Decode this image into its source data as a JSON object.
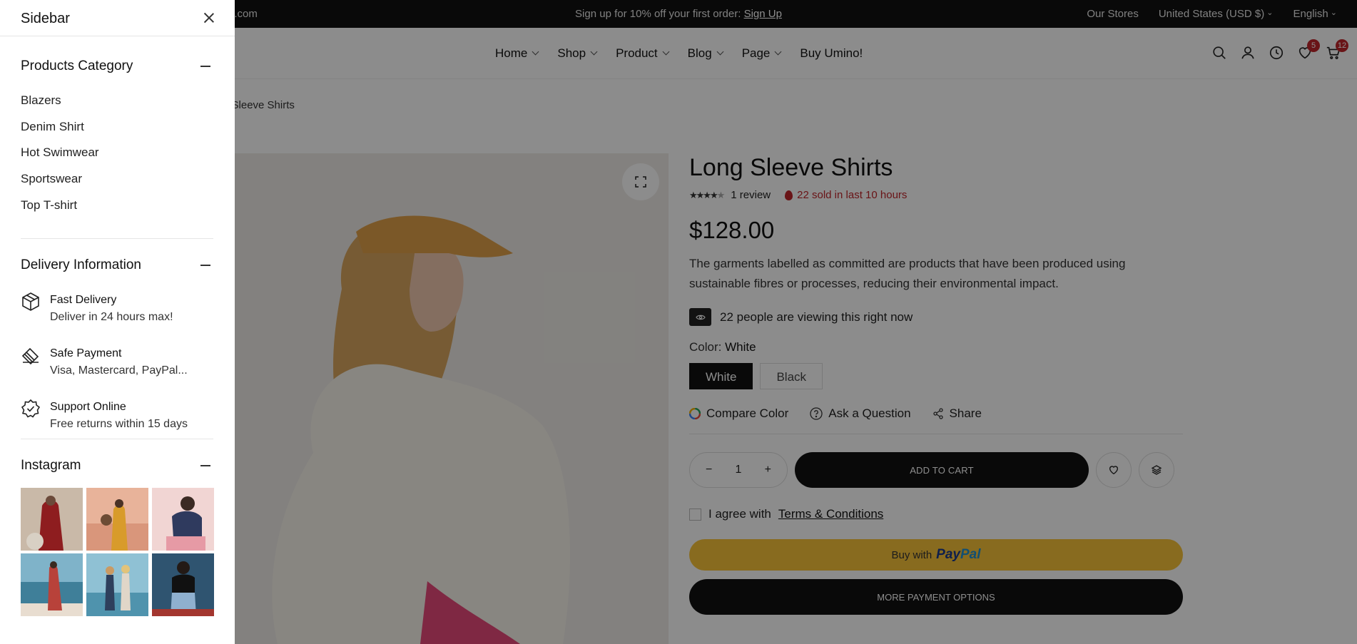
{
  "topbar": {
    "left_text": "l.com",
    "promo_text": "Sign up for 10% off your first order:",
    "promo_link": "Sign Up",
    "our_stores": "Our Stores",
    "currency": "United States (USD $)",
    "language": "English"
  },
  "nav": {
    "items": [
      {
        "label": "Home"
      },
      {
        "label": "Shop"
      },
      {
        "label": "Product"
      },
      {
        "label": "Blog"
      },
      {
        "label": "Page"
      },
      {
        "label": "Buy Umino!"
      }
    ]
  },
  "header": {
    "wishlist_count": "5",
    "cart_count": "12"
  },
  "breadcrumb": "g Sleeve Shirts",
  "product": {
    "title": "Long Sleeve Shirts",
    "rating": 4,
    "rating_max": 5,
    "reviews": "1 review",
    "sold": "22 sold in last 10 hours",
    "price": "$128.00",
    "description": "The garments labelled as committed are products that have been produced using sustainable fibres or processes, reducing their environmental impact.",
    "viewing": "22 people are viewing this right now",
    "color_label": "Color:",
    "color_value": "White",
    "colors": [
      "White",
      "Black"
    ],
    "compare_color": "Compare Color",
    "ask_question": "Ask a Question",
    "share": "Share",
    "quantity": "1",
    "add_to_cart": "ADD TO CART",
    "agree_text": "I agree with",
    "terms_link": "Terms & Conditions",
    "buy_with": "Buy with",
    "paypal_pay": "Pay",
    "paypal_pal": "Pal",
    "more_payment": "MORE PAYMENT OPTIONS"
  },
  "sidebar": {
    "title": "Sidebar",
    "categories_title": "Products Category",
    "categories": [
      "Blazers",
      "Denim Shirt",
      "Hot Swimwear",
      "Sportswear",
      "Top T-shirt"
    ],
    "delivery_title": "Delivery Information",
    "delivery": [
      {
        "title": "Fast Delivery",
        "sub": "Deliver in 24 hours max!",
        "icon": "box-icon"
      },
      {
        "title": "Safe Payment",
        "sub": "Visa, Mastercard, PayPal...",
        "icon": "payment-card-icon"
      },
      {
        "title": "Support Online",
        "sub": "Free returns within 15 days",
        "icon": "verified-badge-icon"
      }
    ],
    "instagram_title": "Instagram"
  },
  "colors": {
    "accent_red": "#c0262b",
    "paypal_yellow": "#f8c33a",
    "dark": "#111111"
  }
}
